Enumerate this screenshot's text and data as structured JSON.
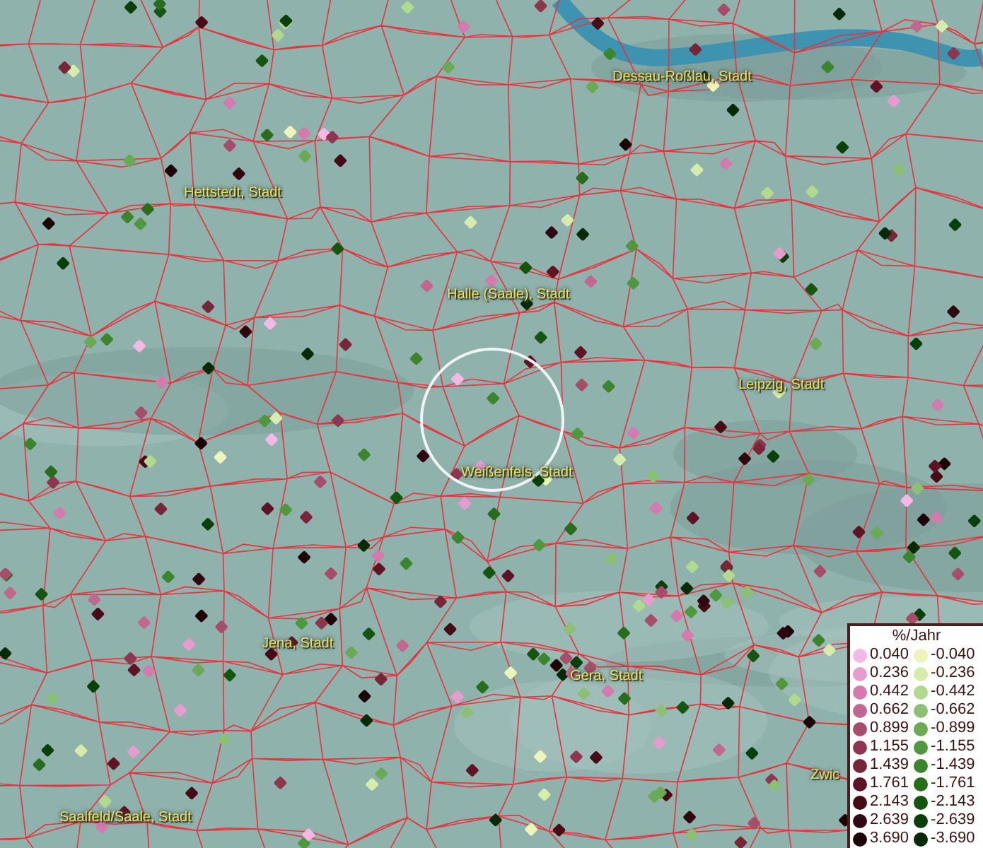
{
  "map": {
    "places": [
      {
        "label": "Dessau-Roßlau, Stadt"
      },
      {
        "label": "Hettstedt, Stadt"
      },
      {
        "label": "Halle (Saale), Stadt"
      },
      {
        "label": "Leipzig, Stadt"
      },
      {
        "label": "Weißenfels, Stadt"
      },
      {
        "label": "Jena, Stadt"
      },
      {
        "label": "Gera, Stadt"
      },
      {
        "label": "Saalfeld/Saale, Stadt"
      },
      {
        "label": "Zwic"
      }
    ]
  },
  "legend": {
    "title": "%/Jahr",
    "positive": [
      {
        "value": "0.040",
        "color": "#f4b8e4"
      },
      {
        "value": "0.236",
        "color": "#e69ccd"
      },
      {
        "value": "0.442",
        "color": "#d47aad"
      },
      {
        "value": "0.662",
        "color": "#c26790"
      },
      {
        "value": "0.899",
        "color": "#a84c6c"
      },
      {
        "value": "1.155",
        "color": "#8e3550"
      },
      {
        "value": "1.439",
        "color": "#772638"
      },
      {
        "value": "1.761",
        "color": "#5e1424"
      },
      {
        "value": "2.143",
        "color": "#470b16"
      },
      {
        "value": "2.639",
        "color": "#300610"
      },
      {
        "value": "3.690",
        "color": "#1c0306"
      }
    ],
    "negative": [
      {
        "value": "-0.040",
        "color": "#eef5b8"
      },
      {
        "value": "-0.236",
        "color": "#d6ecaa"
      },
      {
        "value": "-0.442",
        "color": "#b2da8e"
      },
      {
        "value": "-0.662",
        "color": "#8cc074"
      },
      {
        "value": "-0.899",
        "color": "#6aaa52"
      },
      {
        "value": "-1.155",
        "color": "#4f983e"
      },
      {
        "value": "-1.439",
        "color": "#3c852f"
      },
      {
        "value": "-1.761",
        "color": "#276d1c"
      },
      {
        "value": "-2.143",
        "color": "#145510"
      },
      {
        "value": "-2.639",
        "color": "#0a3f0a"
      },
      {
        "value": "-3.690",
        "color": "#062a06"
      }
    ]
  }
}
